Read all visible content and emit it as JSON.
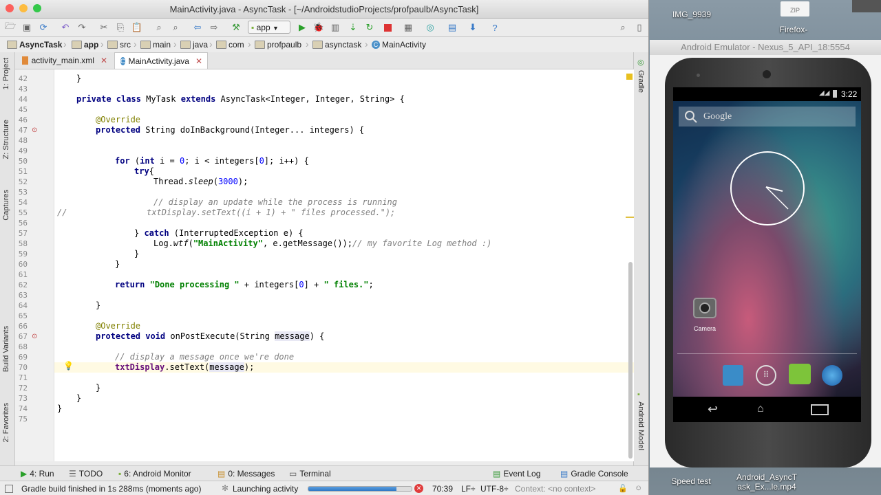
{
  "window": {
    "title": "MainActivity.java - AsyncTask - [~/AndroidstudioProjects/profpaulb/AsyncTask]"
  },
  "toolbar": {
    "run_config": "app"
  },
  "breadcrumb": [
    "AsyncTask",
    "app",
    "src",
    "main",
    "java",
    "com",
    "profpaulb",
    "asynctask",
    "MainActivity"
  ],
  "tabs": [
    {
      "label": "activity_main.xml",
      "active": false
    },
    {
      "label": "MainActivity.java",
      "active": true
    }
  ],
  "left_tools": [
    "1: Project",
    "Z: Structure",
    "Captures",
    "Build Variants",
    "2: Favorites"
  ],
  "right_tools": [
    "Gradle",
    "Android Model"
  ],
  "editor": {
    "line_numbers": [
      "42",
      "43",
      "44",
      "45",
      "46",
      "47",
      "48",
      "49",
      "50",
      "51",
      "52",
      "53",
      "54",
      "55",
      "56",
      "57",
      "58",
      "59",
      "60",
      "61",
      "62",
      "63",
      "64",
      "65",
      "66",
      "67",
      "68",
      "69",
      "70",
      "71",
      "72",
      "73",
      "74",
      "75"
    ],
    "current_line": "70"
  },
  "bottom_tools": [
    {
      "label": "4: Run",
      "icon": "run-icon"
    },
    {
      "label": "TODO",
      "icon": "todo-icon"
    },
    {
      "label": "6: Android Monitor",
      "icon": "android-icon"
    },
    {
      "label": "0: Messages",
      "icon": "messages-icon"
    },
    {
      "label": "Terminal",
      "icon": "terminal-icon"
    },
    {
      "label": "Event Log",
      "icon": "event-log-icon"
    },
    {
      "label": "Gradle Console",
      "icon": "gradle-console-icon"
    }
  ],
  "status": {
    "message": "Gradle build finished in 1s 288ms (moments ago)",
    "task": "Launching activity",
    "progress": 0.85,
    "position": "70:39",
    "line_sep": "LF÷",
    "encoding": "UTF-8÷",
    "context": "Context: <no context>"
  },
  "desktop": {
    "labels": [
      "IMG_9939",
      "ZIP",
      "Firefox-"
    ],
    "dock_items": [
      "Speed test",
      "Android_AsyncT",
      "ask_Ex...le.mp4"
    ]
  },
  "emulator": {
    "title": "Android Emulator - Nexus_5_API_18:5554",
    "time": "3:22",
    "search_placeholder": "Google",
    "app_label": "Camera"
  },
  "colors": {
    "keyword": "#000080",
    "string": "#008000",
    "comment": "#808080",
    "annotation": "#808000",
    "number": "#0000ff"
  }
}
